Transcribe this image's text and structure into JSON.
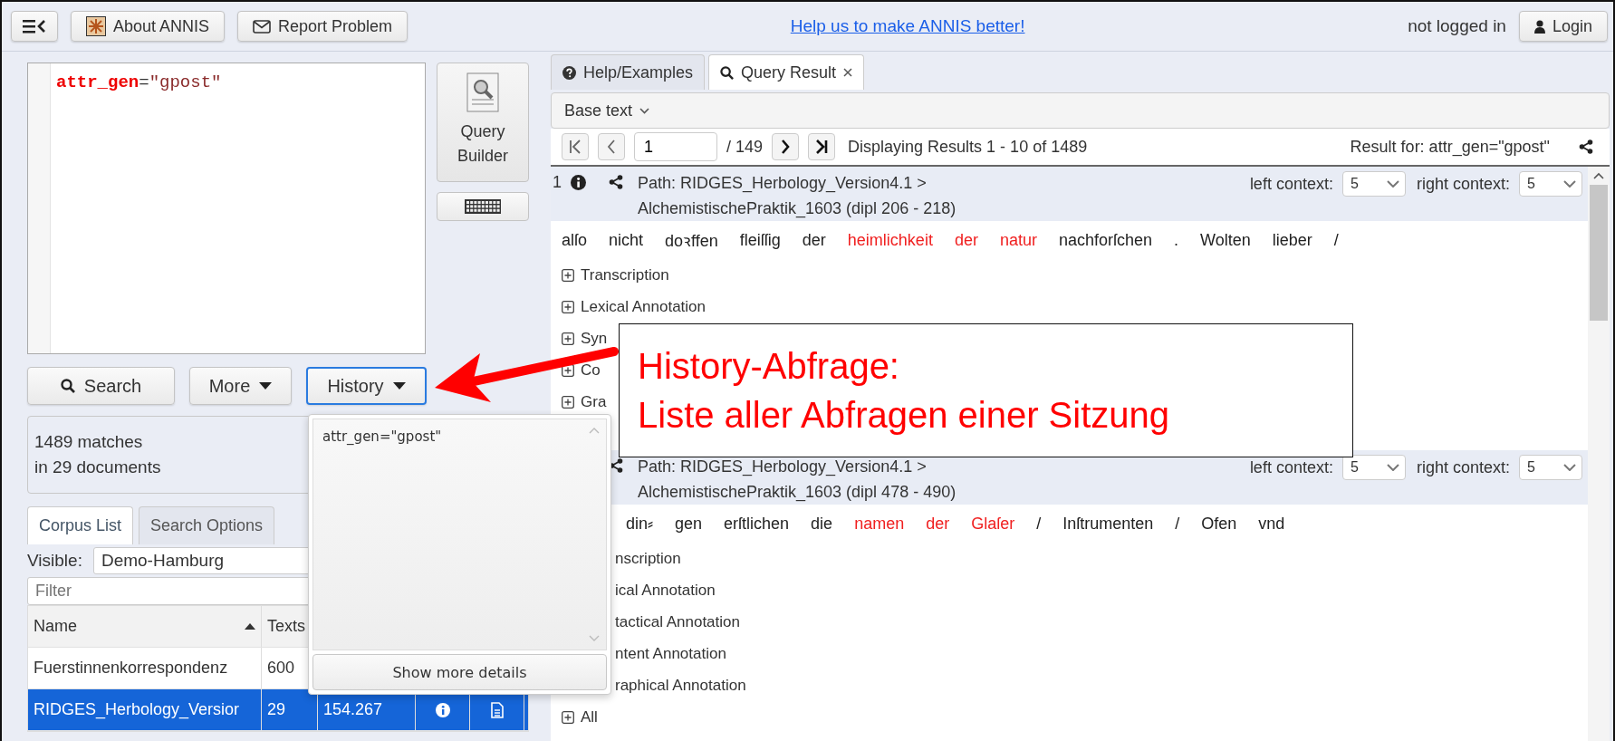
{
  "top_bar": {
    "buttons": [
      "About ANNIS",
      "Report Problem"
    ],
    "link": "Help us to make ANNIS better!",
    "login_status": "not logged in",
    "login_button": "Login"
  },
  "query": {
    "tokens": [
      {
        "text": "attr_gen",
        "kind": "attribute"
      },
      {
        "text": "=",
        "kind": "operator"
      },
      {
        "text": "\"gpost\"",
        "kind": "string"
      }
    ],
    "builder_button": "Query Builder"
  },
  "search_buttons": [
    {
      "label": "Search",
      "kind": "search",
      "focused": false
    },
    {
      "label": "More",
      "kind": "menu",
      "focused": false
    },
    {
      "label": "History",
      "kind": "menu",
      "focused": true
    }
  ],
  "status": {
    "matches": "1489 matches",
    "documents": "in 29 documents"
  },
  "left_tabs": [
    {
      "label": "Corpus List",
      "selected": true
    },
    {
      "label": "Search Options",
      "selected": false
    }
  ],
  "visible": {
    "label": "Visible:",
    "value": "Demo-Hamburg"
  },
  "filter": {
    "placeholder": "Filter"
  },
  "corpus_table": {
    "columns": [
      "Name",
      "Texts"
    ],
    "rows": [
      {
        "cells": [
          "Fuerstinnenkorrespondenz",
          "600"
        ],
        "selected": false
      },
      {
        "cells": [
          "RIDGES_Herbology_Versior",
          "29",
          "154.267"
        ],
        "selected": true
      }
    ]
  },
  "history_popup": {
    "items": [
      "attr_gen=\"gpost\""
    ],
    "button": "Show more details"
  },
  "result_tabs": [
    {
      "label": "Help/Examples",
      "selected": false,
      "closable": false
    },
    {
      "label": "Query Result",
      "selected": true,
      "closable": true
    }
  ],
  "base_text": "Base text",
  "pagination": {
    "page": "1",
    "total": "/ 149",
    "display": "Displaying Results 1 - 10 of 1489",
    "result_for": "Result for: attr_gen=\"gpost\""
  },
  "results": [
    {
      "number": "1",
      "occluded": false,
      "path": "Path: RIDGES_Herbology_Version4.1 >",
      "document": "AlchemistischePraktik_1603 (dipl 206 - 218)",
      "left_context_label": "left context:",
      "left_context": "5",
      "right_context_label": "right context:",
      "right_context": "5",
      "tokens": [
        {
          "text": "alſo",
          "match": false
        },
        {
          "text": "nicht",
          "match": false
        },
        {
          "text": "doꝛffen",
          "match": false
        },
        {
          "text": "fleiſſig",
          "match": false
        },
        {
          "text": "der",
          "match": false
        },
        {
          "text": "heimlichkeit",
          "match": true
        },
        {
          "text": "der",
          "match": true
        },
        {
          "text": "natur",
          "match": true
        },
        {
          "text": "nachforſchen",
          "match": false
        },
        {
          "text": ".",
          "match": false
        },
        {
          "text": "Wolten",
          "match": false
        },
        {
          "text": "lieber",
          "match": false
        },
        {
          "text": "/",
          "match": false
        }
      ],
      "annotations": [
        {
          "label": "Transcription",
          "expander": true
        },
        {
          "label": "Lexical Annotation",
          "expander": true
        },
        {
          "label": "Syn",
          "expander": true
        },
        {
          "label": "Co",
          "expander": true
        },
        {
          "label": "Gra",
          "expander": true
        }
      ]
    },
    {
      "occluded": true,
      "path": "Path: RIDGES_Herbology_Version4.1 >",
      "document": "AlchemistischePraktik_1603 (dipl 478 - 490)",
      "left_context_label": "left context:",
      "left_context": "5",
      "right_context_label": "right context:",
      "right_context": "5",
      "tokens": [
        {
          "text": "din⸗",
          "match": false
        },
        {
          "text": "gen",
          "match": false
        },
        {
          "text": "erſtlichen",
          "match": false
        },
        {
          "text": "die",
          "match": false
        },
        {
          "text": "namen",
          "match": true
        },
        {
          "text": "der",
          "match": true
        },
        {
          "text": "Glaſer",
          "match": true
        },
        {
          "text": "/",
          "match": false
        },
        {
          "text": "Inſtrumenten",
          "match": false
        },
        {
          "text": "/",
          "match": false
        },
        {
          "text": "Ofen",
          "match": false
        },
        {
          "text": "vnd",
          "match": false
        }
      ],
      "annotations": [
        {
          "label": "nscription",
          "expander": false
        },
        {
          "label": "ical Annotation",
          "expander": false
        },
        {
          "label": "tactical Annotation",
          "expander": false
        },
        {
          "label": "ntent Annotation",
          "expander": false
        },
        {
          "label": "raphical Annotation",
          "expander": false
        },
        {
          "label": "All",
          "expander": true
        }
      ]
    }
  ],
  "callout": {
    "lines": [
      "History-Abfrage:",
      "Liste aller Abfragen einer Sitzung"
    ]
  }
}
